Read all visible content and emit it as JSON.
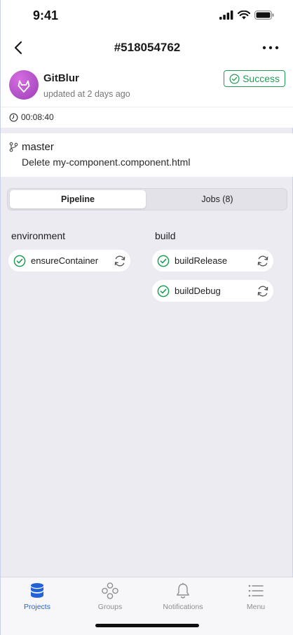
{
  "status_bar": {
    "time": "9:41"
  },
  "nav": {
    "title": "#518054762"
  },
  "project": {
    "name": "GitBlur",
    "updated": "updated at 2 days ago",
    "status": "Success",
    "duration": "00:08:40"
  },
  "branch": {
    "name": "master",
    "commit_message": "Delete my-component.component.html"
  },
  "tabs": {
    "pipeline": "Pipeline",
    "jobs": "Jobs (8)"
  },
  "stages": [
    {
      "name": "environment",
      "jobs": [
        "ensureContainer"
      ]
    },
    {
      "name": "build",
      "jobs": [
        "buildRelease",
        "buildDebug"
      ]
    }
  ],
  "tab_bar": {
    "items": [
      {
        "label": "Projects",
        "icon": "database-icon",
        "active": true
      },
      {
        "label": "Groups",
        "icon": "groups-icon",
        "active": false
      },
      {
        "label": "Notifications",
        "icon": "bell-icon",
        "active": false
      },
      {
        "label": "Menu",
        "icon": "list-icon",
        "active": false
      }
    ]
  },
  "colors": {
    "success": "#1f9d55",
    "accent": "#2162d6",
    "avatar": "#b24fcc"
  }
}
